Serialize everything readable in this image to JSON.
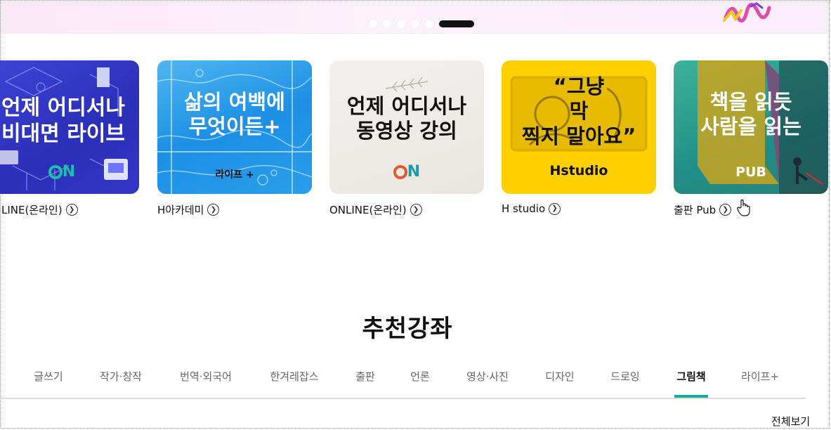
{
  "carousel": {
    "slide_count": 6,
    "active_index": 5
  },
  "cards": [
    {
      "id": "online1",
      "headline": "언제 어디서나\n비대면 라이브",
      "badge": "ON",
      "caption": "LINE(온라인)"
    },
    {
      "id": "hacademy",
      "headline": "삶의 여백에\n무엇이든+",
      "badge": "라이프 +",
      "caption": "H아카데미"
    },
    {
      "id": "online2",
      "headline": "언제 어디서나\n동영상 강의",
      "badge": "ON",
      "caption": "ONLINE(온라인)"
    },
    {
      "id": "hstudio",
      "headline": "“그냥\n막\n찍지 말아요”",
      "badge": "Hstudio",
      "caption": "H studio"
    },
    {
      "id": "pub",
      "headline": "책을 읽듯\n사람을 읽는",
      "badge": "PUB",
      "caption": "출판 Pub"
    }
  ],
  "section": {
    "title": "추천강좌"
  },
  "tabs": [
    {
      "label": "글쓰기",
      "active": false
    },
    {
      "label": "작가·창작",
      "active": false
    },
    {
      "label": "번역·외국어",
      "active": false
    },
    {
      "label": "한겨레잡스",
      "active": false
    },
    {
      "label": "출판",
      "active": false
    },
    {
      "label": "언론",
      "active": false
    },
    {
      "label": "영상·사진",
      "active": false
    },
    {
      "label": "디자인",
      "active": false
    },
    {
      "label": "드로잉",
      "active": false
    },
    {
      "label": "그림책",
      "active": true
    },
    {
      "label": "라이프+",
      "active": false
    }
  ],
  "view_all": "전체보기",
  "colors": {
    "accent": "#1aa59a",
    "hstudio_yellow": "#ffd000"
  },
  "icons": {
    "caption_arrow": "chevron-right-circle-icon",
    "cursor": "hand-pointer-icon"
  }
}
